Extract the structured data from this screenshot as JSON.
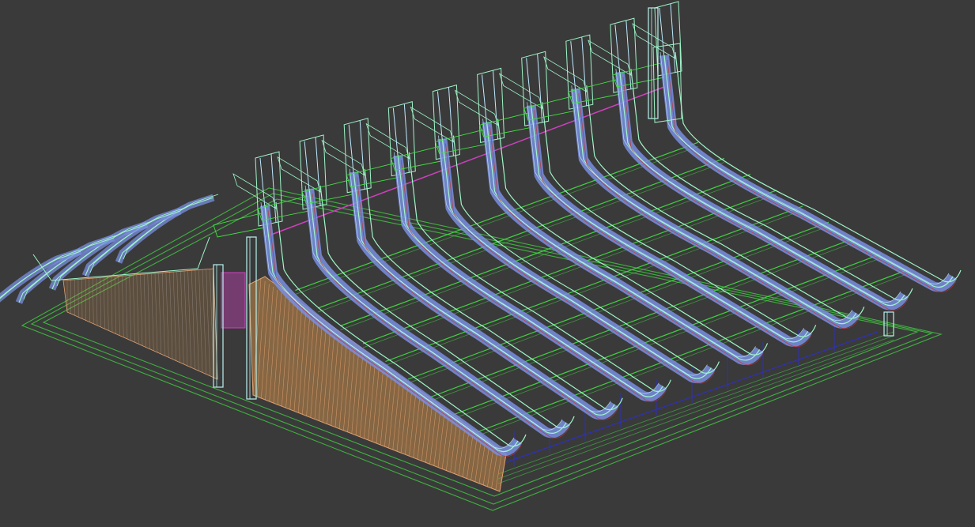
{
  "viewport": {
    "view": "perspective",
    "render_mode": "wireframe",
    "background_color": "#3a3a3a"
  },
  "colors": {
    "ground": "#3fbf3f",
    "rafter_frame": "#9ff5c8",
    "rafter_fill": "#7a8fe0",
    "rafter_mid": "#bfe9ff",
    "purlin": "#41e041",
    "wall": "#c48a4a",
    "wall_lines": "#e0a070",
    "post": "#b8f2ef",
    "magenta": "#d040c0",
    "blue_lines": "#3030b8",
    "red_lines": "#c03030"
  },
  "model": {
    "object": "roof-structure",
    "rafter_count": 10
  }
}
